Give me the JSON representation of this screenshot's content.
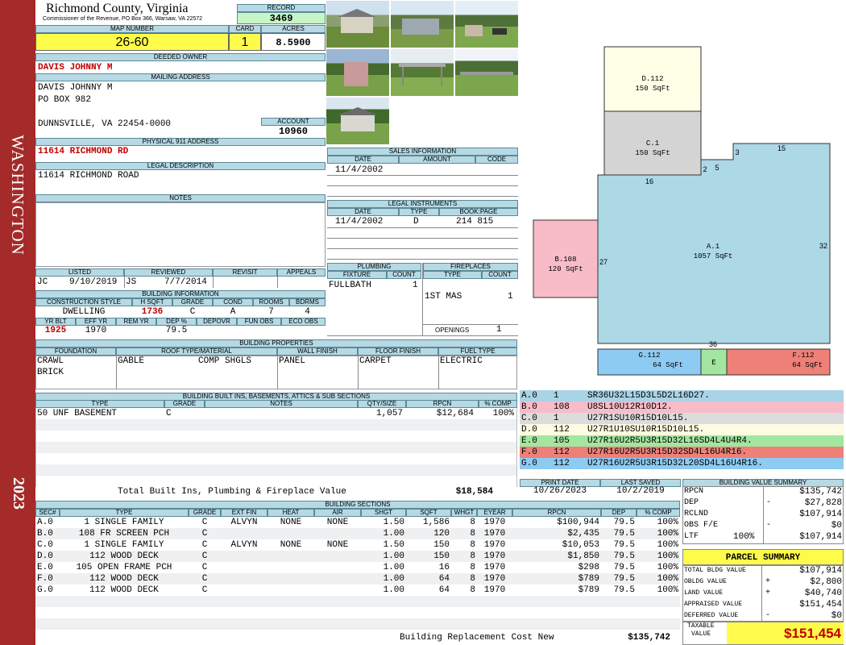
{
  "side": {
    "district": "WASHINGTON",
    "year": "2023"
  },
  "header": {
    "county": "Richmond County, Virginia",
    "commissioner": "Commissioner of the Revenue, PO Box 366, Warsaw, VA 22572",
    "record_label": "RECORD",
    "record": "3469"
  },
  "map": {
    "map_label": "MAP NUMBER",
    "map_number": "26-60",
    "card_label": "CARD",
    "card": "1",
    "acres_label": "ACRES",
    "acres": "8.5900"
  },
  "owner": {
    "deeded_label": "DEEDED OWNER",
    "deeded_owner": "DAVIS JOHNNY M",
    "mailing_label": "MAILING ADDRESS",
    "mail1": "DAVIS JOHNNY M",
    "mail2": "PO BOX 982",
    "mail3": "DUNNSVILLE, VA 22454-0000",
    "account_label": "ACCOUNT",
    "account": "10960"
  },
  "address": {
    "label": "PHYSICAL 911 ADDRESS",
    "value": "11614 RICHMOND RD"
  },
  "legal": {
    "label": "LEGAL DESCRIPTION",
    "value": "11614 RICHMOND ROAD"
  },
  "notes": {
    "label": "NOTES"
  },
  "listing": {
    "listed_label": "LISTED",
    "reviewed_label": "REVIEWED",
    "revisit_label": "REVISIT",
    "appeals_label": "APPEALS",
    "listed_by": "JC",
    "listed_date": "9/10/2019",
    "reviewed_by": "JS",
    "reviewed_date": "7/7/2014"
  },
  "building_info": {
    "label": "BUILDING INFORMATION",
    "h_style": "CONSTRUCTION STYLE",
    "h_sqft": "H SQFT",
    "h_grade": "GRADE",
    "h_cond": "COND",
    "h_rooms": "ROOMS",
    "h_bdrms": "BDRMS",
    "style": "DWELLING",
    "sqft": "1736",
    "grade": "C",
    "cond": "A",
    "rooms": "7",
    "bdrms": "4",
    "h_yrblt": "YR BLT",
    "h_effyr": "EFF YR",
    "h_remyr": "REM YR",
    "h_dep": "DEP %",
    "h_depovr": "DEPOVR",
    "h_funobs": "FUN OBS",
    "h_ecoobs": "ECO OBS",
    "yrblt": "1925",
    "effyr": "1970",
    "dep": "79.5"
  },
  "sales": {
    "label": "SALES INFORMATION",
    "h_date": "DATE",
    "h_amount": "AMOUNT",
    "h_code": "CODE",
    "date": "11/4/2002"
  },
  "instruments": {
    "label": "LEGAL INSTRUMENTS",
    "h_date": "DATE",
    "h_type": "TYPE",
    "h_book": "BOOK:PAGE",
    "date": "11/4/2002",
    "type": "D",
    "book": "214 815"
  },
  "plumbing": {
    "label": "PLUMBING",
    "h_fixture": "FIXTURE",
    "h_count": "COUNT",
    "fixture": "FULLBATH",
    "count": "1"
  },
  "fireplaces": {
    "label": "FIREPLACES",
    "h_type": "TYPE",
    "h_count": "COUNT",
    "type": "1ST MAS",
    "count": "1",
    "openings_label": "OPENINGS",
    "openings": "1"
  },
  "properties": {
    "label": "BUILDING PROPERTIES",
    "h_foundation": "FOUNDATION",
    "h_roof": "ROOF TYPE/MATERIAL",
    "h_wall": "WALL FINISH",
    "h_floor": "FLOOR FINISH",
    "h_fuel": "FUEL TYPE",
    "foundation1": "CRAWL",
    "foundation2": "BRICK",
    "roof_type": "GABLE",
    "roof_material": "COMP SHGLS",
    "wall": "PANEL",
    "floor": "CARPET",
    "fuel": "ELECTRIC"
  },
  "builtins": {
    "label": "BUILDING BUILT INS, BASEMENTS, ATTICS & SUB SECTIONS",
    "h_type": "TYPE",
    "h_grade": "GRADE",
    "h_notes": "NOTES",
    "h_qty": "QTY/SIZE",
    "h_rpcn": "RPCN",
    "h_comp": "% COMP",
    "type": "50 UNF BASEMENT",
    "grade": "C",
    "qty": "1,057",
    "rpcn": "$12,684",
    "comp": "100%",
    "total_label": "Total Built Ins, Plumbing & Fireplace Value",
    "total": "$18,584"
  },
  "print": {
    "print_label": "PRINT DATE",
    "saved_label": "LAST SAVED",
    "print_date": "10/26/2023",
    "saved_date": "10/2/2019"
  },
  "sections": {
    "label": "BUILDING SECTIONS",
    "headers": [
      "SEC#",
      "TYPE",
      "GRADE",
      "EXT FIN",
      "HEAT",
      "AIR",
      "SHGT",
      "SQFT",
      "WHGT",
      "EYEAR",
      "RPCN",
      "DEP",
      "% COMP"
    ],
    "rows": [
      [
        "A.0",
        "1 SINGLE FAMILY",
        "C",
        "ALVYN",
        "NONE",
        "NONE",
        "1.50",
        "1,586",
        "8",
        "1970",
        "$100,944",
        "79.5",
        "100%"
      ],
      [
        "B.0",
        "108 FR SCREEN PCH",
        "C",
        "",
        "",
        "",
        "1.00",
        "120",
        "8",
        "1970",
        "$2,435",
        "79.5",
        "100%"
      ],
      [
        "C.0",
        "1 SINGLE FAMILY",
        "C",
        "ALVYN",
        "NONE",
        "NONE",
        "1.50",
        "150",
        "8",
        "1970",
        "$10,053",
        "79.5",
        "100%"
      ],
      [
        "D.0",
        "112 WOOD DECK",
        "C",
        "",
        "",
        "",
        "1.00",
        "150",
        "8",
        "1970",
        "$1,850",
        "79.5",
        "100%"
      ],
      [
        "E.0",
        "105 OPEN FRAME PCH",
        "C",
        "",
        "",
        "",
        "1.00",
        "16",
        "8",
        "1970",
        "$298",
        "79.5",
        "100%"
      ],
      [
        "F.0",
        "112 WOOD DECK",
        "C",
        "",
        "",
        "",
        "1.00",
        "64",
        "8",
        "1970",
        "$789",
        "79.5",
        "100%"
      ],
      [
        "G.0",
        "112 WOOD DECK",
        "C",
        "",
        "",
        "",
        "1.00",
        "64",
        "8",
        "1970",
        "$789",
        "79.5",
        "100%"
      ]
    ],
    "replacement_label": "Building Replacement Cost New",
    "replacement": "$135,742"
  },
  "sketch": {
    "labels": [
      {
        "code": "D.112",
        "area": "150 SqFt"
      },
      {
        "code": "C.1",
        "area": "150 SqFt"
      },
      {
        "code": "A.1",
        "area": "1057 SqFt"
      },
      {
        "code": "B.108",
        "area": "120 SqFt"
      },
      {
        "code": "G.112",
        "area": "64 SqFt"
      },
      {
        "code": "E",
        "area": ""
      },
      {
        "code": "F.112",
        "area": "64 SqFt"
      }
    ],
    "dims": [
      "15",
      "3",
      "2",
      "5",
      "16",
      "27",
      "32",
      "36"
    ]
  },
  "codes": [
    {
      "sec": "A.0",
      "num": "1",
      "code": "SR36U32L15D3L5D2L16D27.",
      "color": "#a9d3e6"
    },
    {
      "sec": "B.0",
      "num": "108",
      "code": "U8SL10U12R10D12.",
      "color": "#f7bcc8"
    },
    {
      "sec": "C.0",
      "num": "1",
      "code": "U27R1SU10R15D10L15.",
      "color": "#dcdcdc"
    },
    {
      "sec": "D.0",
      "num": "112",
      "code": "U27R1U10SU10R15D10L15.",
      "color": "#fdfbe1"
    },
    {
      "sec": "E.0",
      "num": "105",
      "code": "U27R16U2R5U3R15D32L16SD4L4U4R4.",
      "color": "#a3e6a0"
    },
    {
      "sec": "F.0",
      "num": "112",
      "code": "U27R16U2R5U3R15D32SD4L16U4R16.",
      "color": "#ee8078"
    },
    {
      "sec": "G.0",
      "num": "112",
      "code": "U27R16U2R5U3R15D32L20SD4L16U4R16.",
      "color": "#8ecbf2"
    }
  ],
  "value_summary": {
    "label": "BUILDING VALUE SUMMARY",
    "rpcn_label": "RPCN",
    "rpcn": "$135,742",
    "dep_label": "DEP",
    "dep_sign": "-",
    "dep": "$27,828",
    "rclnd_label": "RCLND",
    "rclnd": "$107,914",
    "obs_label": "OBS F/E",
    "obs_sign": "-",
    "obs": "$0",
    "ltf_label": "LTF",
    "ltf_pct": "100%",
    "ltf": "$107,914"
  },
  "parcel": {
    "title": "PARCEL SUMMARY",
    "bldg_label": "TOTAL BLDG VALUE",
    "bldg": "$107,914",
    "obldg_label": "OBLDG VALUE",
    "obldg_sign": "+",
    "obldg": "$2,800",
    "land_label": "LAND VALUE",
    "land_sign": "+",
    "land": "$40,740",
    "appraised_label": "APPRAISED VALUE",
    "appraised": "$151,454",
    "deferred_label": "DEFERRED VALUE",
    "deferred_sign": "-",
    "deferred": "$0",
    "taxable_label1": "TAXABLE",
    "taxable_label2": "VALUE",
    "taxable": "$151,454"
  },
  "colors": {
    "sidebar": "#a52a2a",
    "header_blue": "#b6d9e4",
    "yellow": "#fffb4a",
    "record_green": "#c6f5c6"
  }
}
